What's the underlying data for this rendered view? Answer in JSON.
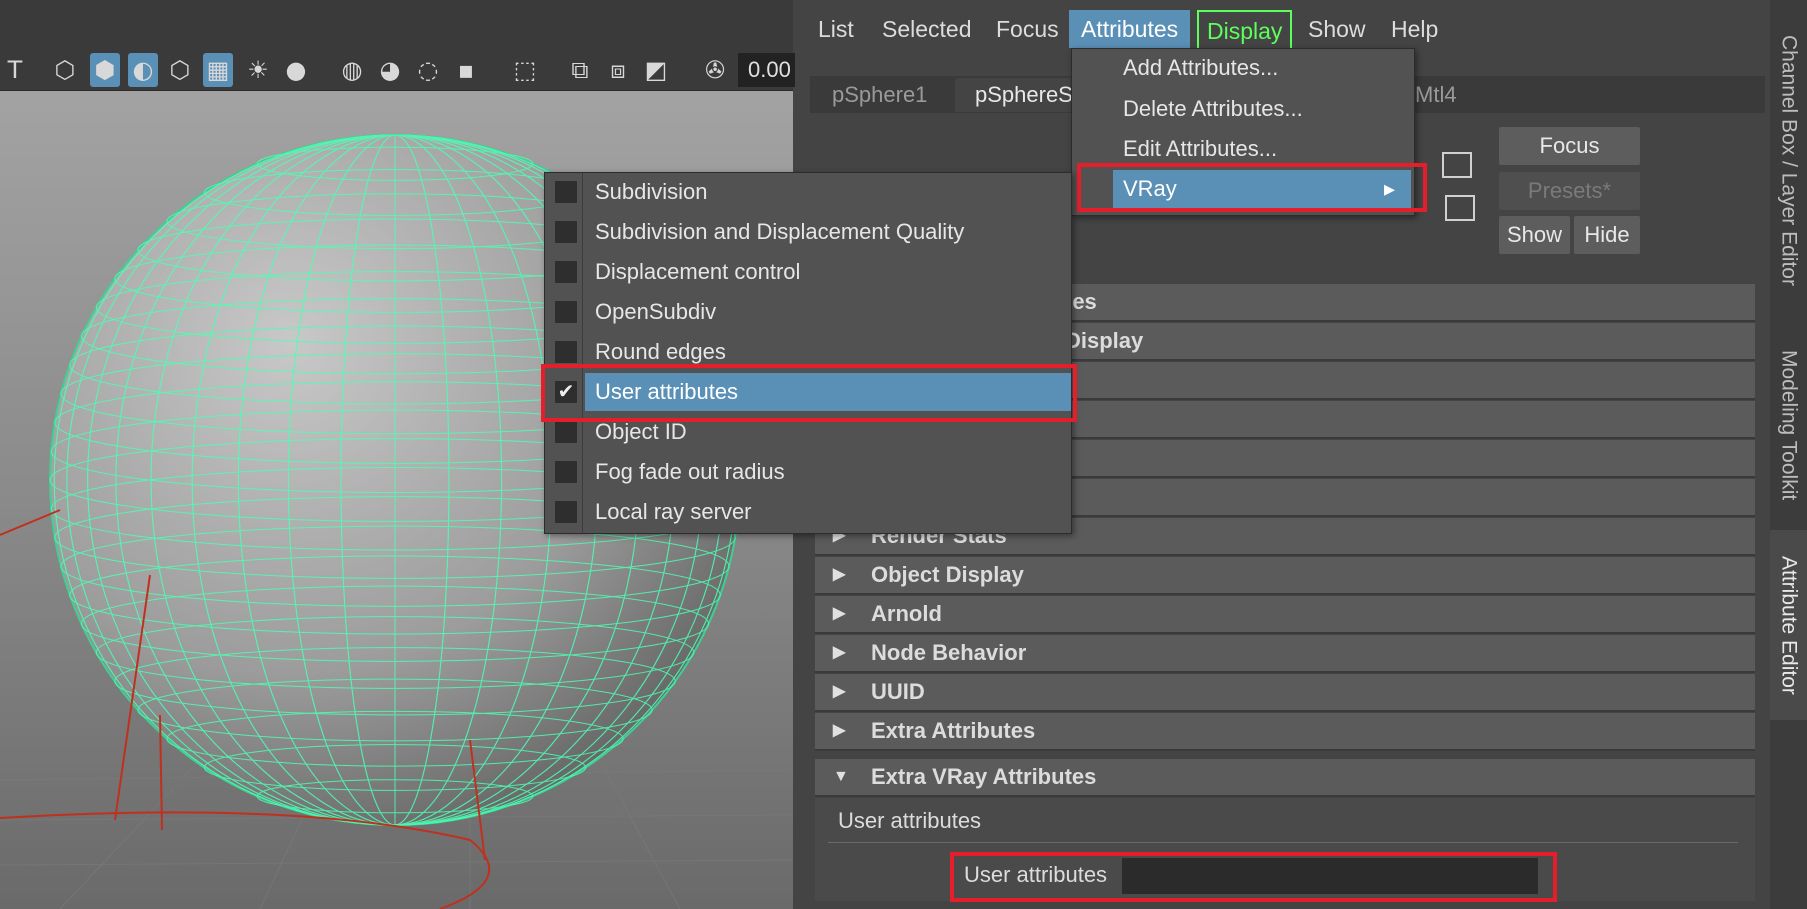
{
  "toolbar": {
    "value": "0.00"
  },
  "right_panel": {
    "menubar": [
      {
        "label": "List"
      },
      {
        "label": "Selected"
      },
      {
        "label": "Focus"
      },
      {
        "label": "Attributes"
      },
      {
        "label": "Display"
      },
      {
        "label": "Show"
      },
      {
        "label": "Help"
      }
    ],
    "tabs": [
      "pSphere1",
      "pSphereS",
      "Mtl4"
    ],
    "buttons": {
      "focus": "Focus",
      "presets": "Presets*",
      "show": "Show",
      "hide": "Hide"
    },
    "sections": [
      {
        "label": "tes"
      },
      {
        "label": "Display"
      },
      {
        "label": "Render Stats"
      },
      {
        "label": "Object Display"
      },
      {
        "label": "Arnold"
      },
      {
        "label": "Node Behavior"
      },
      {
        "label": "UUID"
      },
      {
        "label": "Extra Attributes"
      },
      {
        "label": "Extra VRay Attributes"
      }
    ],
    "extra_vray": {
      "subheader": "User attributes",
      "field_label": "User attributes",
      "field_value": ""
    }
  },
  "attributes_menu": {
    "items": [
      "Add Attributes...",
      "Delete Attributes...",
      "Edit Attributes...",
      "VRay"
    ],
    "submenu_arrow": "▸"
  },
  "vray_submenu": {
    "items": [
      {
        "label": "Subdivision",
        "checked": false
      },
      {
        "label": "Subdivision and Displacement Quality",
        "checked": false
      },
      {
        "label": "Displacement control",
        "checked": false
      },
      {
        "label": "OpenSubdiv",
        "checked": false
      },
      {
        "label": "Round edges",
        "checked": false
      },
      {
        "label": "User attributes",
        "checked": true
      },
      {
        "label": "Object ID",
        "checked": false
      },
      {
        "label": "Fog fade out radius",
        "checked": false
      },
      {
        "label": "Local ray server",
        "checked": false
      }
    ],
    "check_glyph": "✔"
  },
  "side_tabs": [
    "Channel Box / Layer Editor",
    "Modeling Toolkit",
    "Attribute Editor"
  ],
  "colors": {
    "highlight": "#5a8fb6",
    "annotation": "#e51e2b",
    "wireframe": "#4dffb4"
  }
}
